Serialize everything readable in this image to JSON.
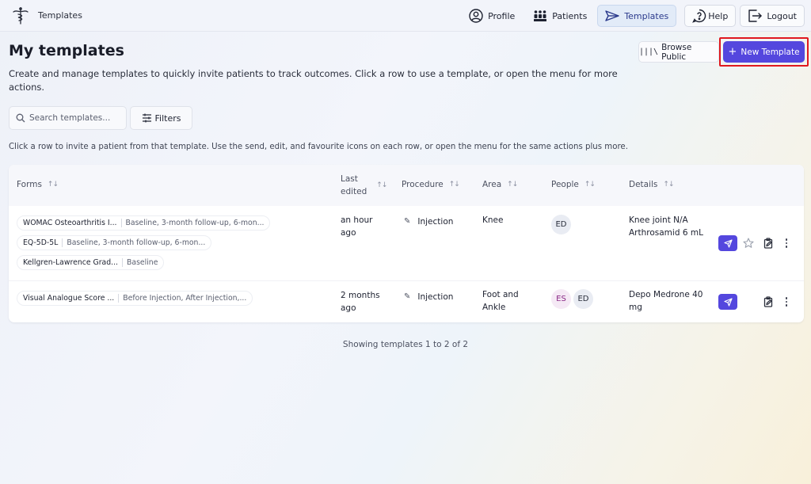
{
  "app": {
    "title": "Templates",
    "logo_icon": "caduceus-icon"
  },
  "nav": {
    "profile": "Profile",
    "patients": "Patients",
    "templates": "Templates",
    "help": "Help",
    "logout": "Logout"
  },
  "page": {
    "title": "My templates",
    "description": "Create and manage templates to quickly invite patients to track outcomes. Click a row to use a template, or open the menu for more actions.",
    "hint": "Click a row to invite a patient from that template. Use the send, edit, and favourite icons on each row, or open the menu for the same actions plus more."
  },
  "actions": {
    "browse_public": "Browse Public",
    "new_template": "New Template"
  },
  "search": {
    "placeholder": "Search templates..."
  },
  "filters_label": "Filters",
  "table": {
    "columns": {
      "forms": "Forms",
      "last_edited_1": "Last",
      "last_edited_2": "edited",
      "procedure": "Procedure",
      "area": "Area",
      "people": "People",
      "details": "Details"
    },
    "rows": [
      {
        "forms": [
          {
            "name": "WOMAC Osteoarthritis I...",
            "desc": "Baseline, 3-month follow-up, 6-mon..."
          },
          {
            "name": "EQ-5D-5L",
            "desc": "Baseline, 3-month follow-up, 6-mon..."
          },
          {
            "name": "Kellgren-Lawrence Grad...",
            "desc": "Baseline"
          }
        ],
        "last_edited_1": "an hour",
        "last_edited_2": "ago",
        "procedure": "Injection",
        "area_1": "Knee",
        "area_2": "",
        "people": [
          "ED"
        ],
        "details_1": "Knee joint N/A",
        "details_2": "Arthrosamid 6 mL",
        "favourite": false
      },
      {
        "forms": [
          {
            "name": "Visual Analogue Score ...",
            "desc": "Before Injection, After Injection,..."
          }
        ],
        "last_edited_1": "2 months",
        "last_edited_2": "ago",
        "procedure": "Injection",
        "area_1": "Foot and",
        "area_2": "Ankle",
        "people": [
          "ES",
          "ED"
        ],
        "details_1": "Depo Medrone 40",
        "details_2": "mg"
      }
    ]
  },
  "footer": "Showing templates 1 to 2 of 2",
  "colors": {
    "accent": "#5447de",
    "highlight_border": "#e0181f"
  }
}
